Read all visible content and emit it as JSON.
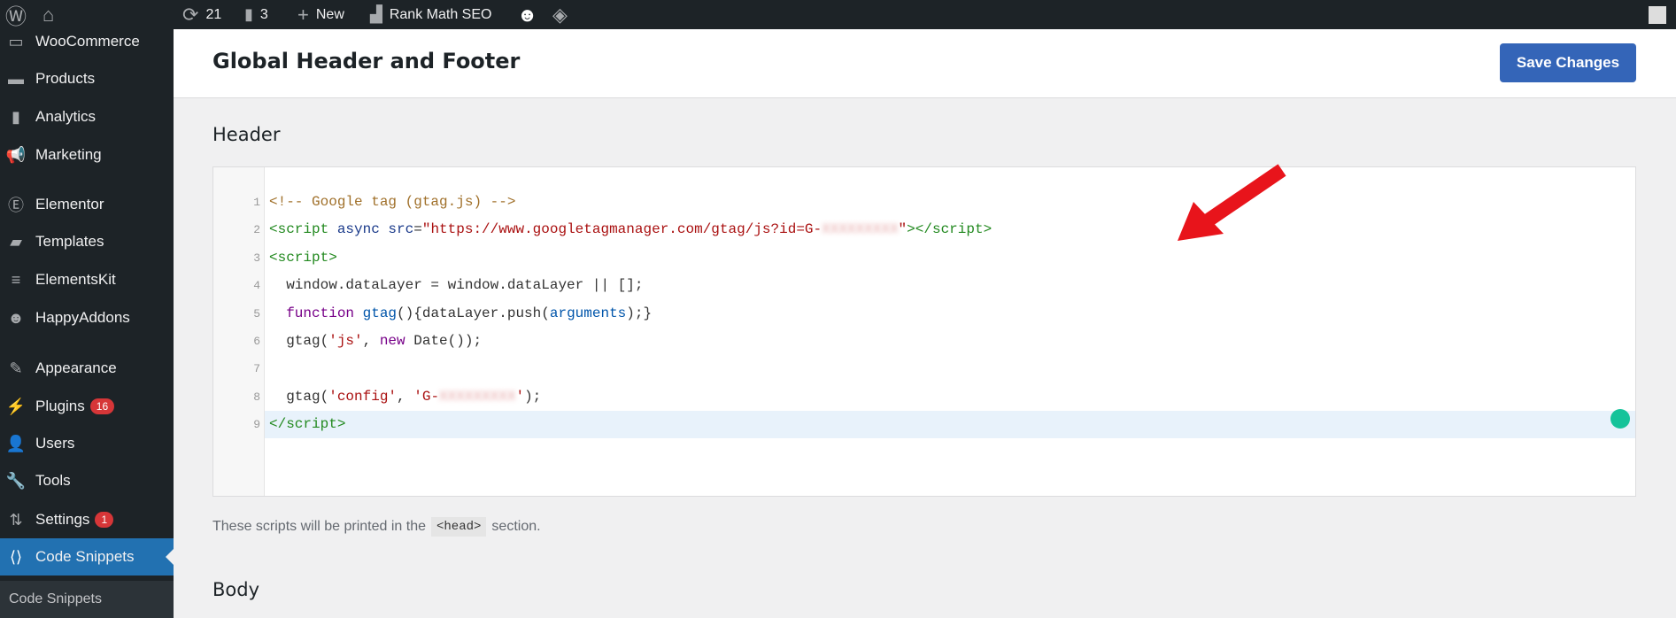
{
  "adminbar": {
    "updates": "21",
    "comments": "3",
    "new": "New",
    "rankmath": "Rank Math SEO"
  },
  "sidebar": {
    "items": [
      {
        "label": "WooCommerce",
        "icon": "woo-icon"
      },
      {
        "label": "Products",
        "icon": "archive-icon"
      },
      {
        "label": "Analytics",
        "icon": "bar-chart-icon"
      },
      {
        "label": "Marketing",
        "icon": "megaphone-icon"
      },
      {
        "label": "Elementor",
        "icon": "elementor-icon"
      },
      {
        "label": "Templates",
        "icon": "folder-icon"
      },
      {
        "label": "ElementsKit",
        "icon": "elementskit-icon"
      },
      {
        "label": "HappyAddons",
        "icon": "happy-face-icon"
      },
      {
        "label": "Appearance",
        "icon": "brush-icon"
      },
      {
        "label": "Plugins",
        "icon": "plug-icon",
        "badge": "16"
      },
      {
        "label": "Users",
        "icon": "user-icon"
      },
      {
        "label": "Tools",
        "icon": "wrench-icon"
      },
      {
        "label": "Settings",
        "icon": "settings-icon",
        "badge": "1"
      },
      {
        "label": "Code Snippets",
        "icon": "code-icon",
        "active": true
      }
    ],
    "submenu": "Code Snippets"
  },
  "page": {
    "title": "Global Header and Footer",
    "save": "Save Changes",
    "header_label": "Header",
    "body_label": "Body",
    "help_before": "These scripts will be printed in the",
    "help_code": "<head>",
    "help_after": "section."
  },
  "colors": {
    "accent": "#2271b1",
    "button": "#3465b8",
    "arrow": "#e8141b"
  },
  "editor": {
    "lines": [
      [
        [
          "c-com",
          "<!-- Google tag (gtag.js) -->"
        ]
      ],
      [
        [
          "c-tag",
          "<script "
        ],
        [
          "c-attr",
          "async src"
        ],
        [
          "",
          "="
        ],
        [
          "c-str",
          "\"https://www.googletagmanager.com/gtag/js?id=G-"
        ],
        [
          "c-blur",
          "XXXXXXXXX"
        ],
        [
          "c-str",
          "\""
        ],
        [
          "c-tag",
          "></script>"
        ]
      ],
      [
        [
          "c-tag",
          "<script>"
        ]
      ],
      [
        [
          "",
          "  window.dataLayer = window.dataLayer || [];"
        ]
      ],
      [
        [
          "c-kw",
          "  function "
        ],
        [
          "c-def",
          "gtag"
        ],
        [
          "",
          "(){dataLayer.push("
        ],
        [
          "c-def",
          "arguments"
        ],
        [
          "",
          ");}"
        ]
      ],
      [
        [
          "",
          "  gtag("
        ],
        [
          "c-str",
          "'js'"
        ],
        [
          "",
          ", "
        ],
        [
          "c-kw",
          "new "
        ],
        [
          "",
          "Date());"
        ]
      ],
      [
        [
          "",
          ""
        ]
      ],
      [
        [
          "",
          "  gtag("
        ],
        [
          "c-str",
          "'config'"
        ],
        [
          "",
          ", "
        ],
        [
          "c-str",
          "'G-"
        ],
        [
          "c-blur",
          "XXXXXXXXX"
        ],
        [
          "c-str",
          "'"
        ],
        [
          "",
          ");"
        ]
      ],
      [
        [
          "c-tag",
          "</script>"
        ]
      ]
    ]
  }
}
